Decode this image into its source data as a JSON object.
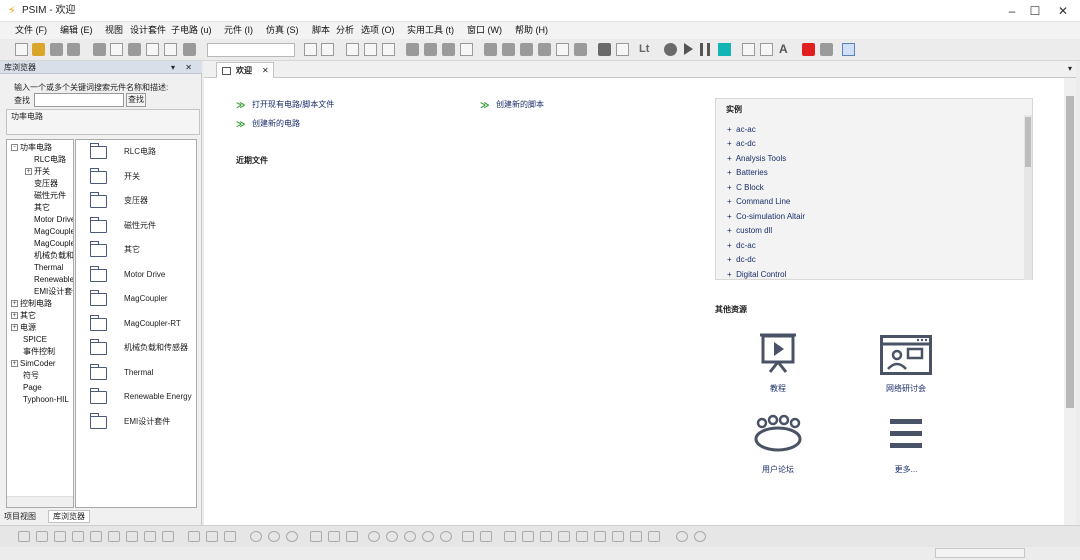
{
  "window": {
    "title": "PSIM - 欢迎",
    "controls": {
      "minimize": "–",
      "maximize": "☐",
      "close": "✕"
    }
  },
  "menubar": {
    "items": [
      "文件 (F)",
      "编辑 (E)",
      "视图",
      "设计套件",
      "子电路 (u)",
      "元件 (I)",
      "仿真 (S)",
      "脚本",
      "分析",
      "选项 (O)",
      "实用工具 (t)",
      "窗口 (W)",
      "帮助 (H)"
    ]
  },
  "toolbar": {
    "label_lt": "Lt",
    "label_a": "A",
    "icons": [
      "new-file-icon",
      "open-folder-icon",
      "save-icon",
      "print-icon",
      "cut-icon",
      "copy-icon",
      "paste-icon",
      "undo-icon",
      "redo-icon",
      "clipboard-icon",
      "checkmark-icon",
      "cross-icon",
      "rotate-icon",
      "flip-icon",
      "mirror-icon",
      "wire-icon",
      "label-icon",
      "pan-hand-icon",
      "select-icon",
      "zoom-in-icon",
      "zoom-out-icon",
      "zoom-fit-icon",
      "zoom-area-icon",
      "zoom-page-icon",
      "hand-icon",
      "element-icon",
      "probe-icon",
      "stop-icon",
      "run-icon",
      "pause-icon",
      "simview-icon",
      "pen-icon",
      "tool-icon",
      "typhoon-icon",
      "bird-icon",
      "doc-icon"
    ]
  },
  "library": {
    "header": "库浏览器",
    "controls": "▾ ✕",
    "search_hint": "输入一个或多个关键词搜索元件名称和描述:",
    "search_label": "查找",
    "search_value": "",
    "search_button": "查找",
    "path": "功率电路",
    "tree": [
      {
        "label": "功率电路",
        "expander": "⊟",
        "indent": 0
      },
      {
        "label": "RLC电路",
        "expander": "",
        "indent": 1
      },
      {
        "label": "开关",
        "expander": "⊞",
        "indent": 1
      },
      {
        "label": "变压器",
        "expander": "",
        "indent": 1
      },
      {
        "label": "磁性元件",
        "expander": "",
        "indent": 1
      },
      {
        "label": "其它",
        "expander": "",
        "indent": 1
      },
      {
        "label": "Motor Drive",
        "expander": "",
        "indent": 1
      },
      {
        "label": "MagCoupler",
        "expander": "",
        "indent": 1
      },
      {
        "label": "MagCoupler-RT",
        "expander": "",
        "indent": 1
      },
      {
        "label": "机械负载和传感器",
        "expander": "",
        "indent": 1
      },
      {
        "label": "Thermal",
        "expander": "",
        "indent": 1
      },
      {
        "label": "Renewable Energy",
        "expander": "",
        "indent": 1
      },
      {
        "label": "EMI设计套件",
        "expander": "",
        "indent": 1
      },
      {
        "label": "控制电路",
        "expander": "⊞",
        "indent": 0
      },
      {
        "label": "其它",
        "expander": "⊞",
        "indent": 0
      },
      {
        "label": "电源",
        "expander": "⊞",
        "indent": 0
      },
      {
        "label": "SPICE",
        "expander": "",
        "indent": 0
      },
      {
        "label": "事件控制",
        "expander": "",
        "indent": 0
      },
      {
        "label": "SimCoder",
        "expander": "⊞",
        "indent": 0
      },
      {
        "label": "符号",
        "expander": "",
        "indent": 0
      },
      {
        "label": "Page",
        "expander": "",
        "indent": 0
      },
      {
        "label": "Typhoon-HIL",
        "expander": "",
        "indent": 0
      }
    ],
    "list": [
      "RLC电路",
      "开关",
      "变压器",
      "磁性元件",
      "其它",
      "Motor Drive",
      "MagCoupler",
      "MagCoupler-RT",
      "机械负载和传感器",
      "Thermal",
      "Renewable Energy",
      "EMI设计套件"
    ],
    "tabs": {
      "project": "项目视图",
      "library": "库浏览器"
    }
  },
  "document": {
    "tab_label": "欢迎",
    "tab_close": "✕",
    "tab_menu": "▾",
    "links": {
      "open": "打开现有电路/脚本文件",
      "new_circuit": "创建新的电路",
      "new_script": "创建新的脚本"
    },
    "recent_title": "近期文件",
    "examples": {
      "title": "实例",
      "items": [
        "ac-ac",
        "ac-dc",
        "Analysis Tools",
        "Batteries",
        "C Block",
        "Command Line",
        "Co-simulation Altair",
        "custom dll",
        "dc-ac",
        "dc-dc",
        "Digital Control"
      ],
      "expander": "+"
    },
    "other_title": "其他资源",
    "resources": [
      {
        "label": "教程",
        "icon": "presentation-icon"
      },
      {
        "label": "网络研讨会",
        "icon": "webinar-icon"
      },
      {
        "label": "用户论坛",
        "icon": "forum-icon"
      },
      {
        "label": "更多...",
        "icon": "menu-icon"
      }
    ]
  },
  "colors": {
    "link": "#1b2e6b",
    "accent_green": "#2b9a2b",
    "title_icon": "#e8a317"
  }
}
